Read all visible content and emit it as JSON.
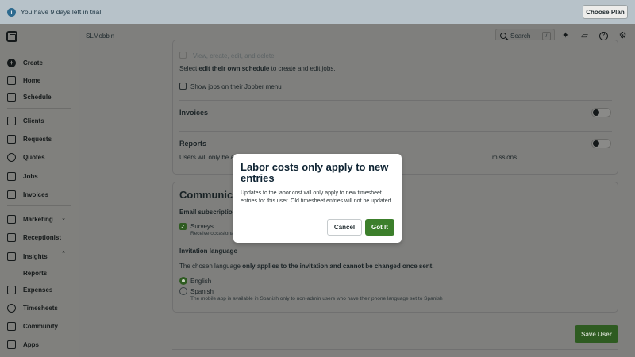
{
  "banner": {
    "message": "You have 9 days left in trial",
    "choose_plan": "Choose Plan"
  },
  "topbar": {
    "account": "SLMobbin",
    "search_placeholder": "Search",
    "search_shortcut": "/"
  },
  "sidebar": {
    "items": [
      {
        "label": "Create",
        "icon": "plus-circle-icon"
      },
      {
        "label": "Home",
        "icon": "home-icon"
      },
      {
        "label": "Schedule",
        "icon": "calendar-icon"
      },
      {
        "label": "Clients",
        "icon": "clients-icon"
      },
      {
        "label": "Requests",
        "icon": "requests-icon"
      },
      {
        "label": "Quotes",
        "icon": "quotes-icon"
      },
      {
        "label": "Jobs",
        "icon": "jobs-icon"
      },
      {
        "label": "Invoices",
        "icon": "invoices-icon"
      },
      {
        "label": "Marketing",
        "icon": "marketing-icon"
      },
      {
        "label": "Receptionist",
        "icon": "receptionist-icon"
      },
      {
        "label": "Insights",
        "icon": "insights-icon"
      },
      {
        "label": "Reports",
        "icon": ""
      },
      {
        "label": "Expenses",
        "icon": "expenses-icon"
      },
      {
        "label": "Timesheets",
        "icon": "clock-icon"
      },
      {
        "label": "Community",
        "icon": "community-icon"
      },
      {
        "label": "Apps",
        "icon": "apps-icon"
      }
    ]
  },
  "permissions": {
    "view_create_edit_delete": "View, create, edit, and delete",
    "schedule_note_prefix": "Select ",
    "schedule_note_bold": "edit their own schedule",
    "schedule_note_suffix": " to create and edit jobs.",
    "show_jobs_label": "Show jobs on their Jobber menu",
    "invoices_label": "Invoices",
    "reports_label": "Reports",
    "reports_note_start": "Users will only be al",
    "reports_note_end": "missions."
  },
  "communication": {
    "heading": "Communica",
    "email_subscriptions_label": "Email subscriptio",
    "surveys_label": "Surveys",
    "surveys_sub": "Receive occasiona",
    "invitation_language_label": "Invitation language",
    "language_note_prefix": "The chosen language ",
    "language_note_bold": "only applies to the invitation and cannot be changed once sent.",
    "english_label": "English",
    "spanish_label": "Spanish",
    "spanish_note": "The mobile app is available in Spanish only to non-admin users who have their phone language set to Spanish",
    "selected_language": "English"
  },
  "save_user_label": "Save User",
  "modal": {
    "title": "Labor costs only apply to new entries",
    "body": "Updates to the labor cost will only apply to new timesheet entries for this user. Old timesheet entries will not be updated.",
    "cancel_label": "Cancel",
    "confirm_label": "Got It"
  },
  "colors": {
    "accent_green": "#3c7f2b",
    "banner_bg": "#b7c2c9",
    "overlay": "#7f7f7d"
  }
}
